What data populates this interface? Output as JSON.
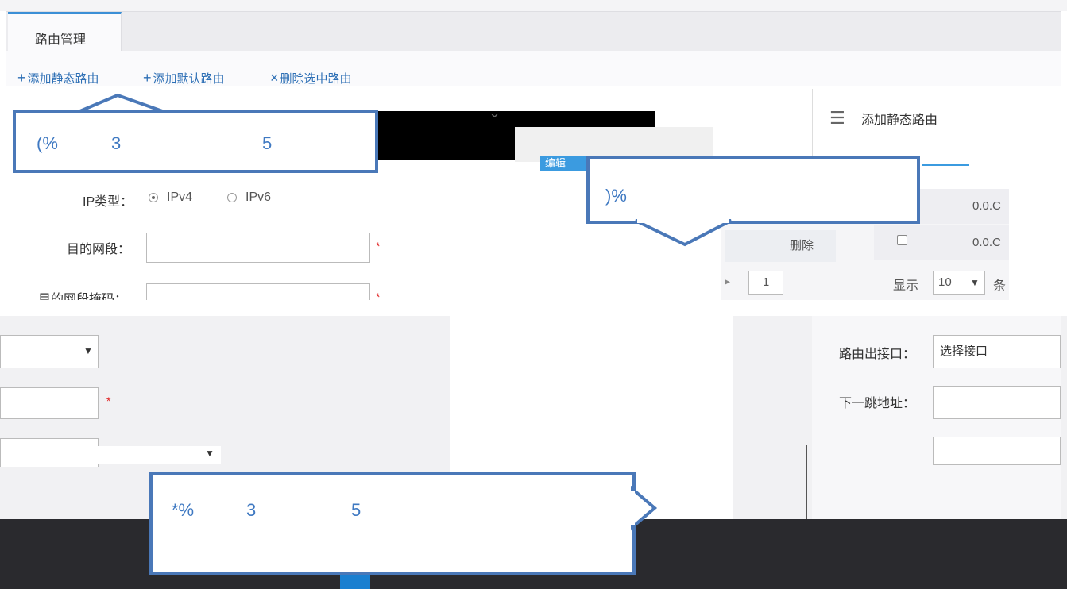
{
  "tab": {
    "label": "路由管理"
  },
  "toolbar": {
    "add_static": "添加静态路由",
    "add_default": "添加默认路由",
    "delete_selected": "删除选中路由"
  },
  "right_panel": {
    "title": "添加静态路由"
  },
  "form": {
    "ip_type_label": "IP类型：",
    "ipv4": "IPv4",
    "ipv6": "IPv6",
    "dest_segment_label": "目的网段：",
    "dest_mask_label": "目的网段掩码：",
    "required_mark": "*"
  },
  "table": {
    "rows": [
      {
        "ip": "0.0.C"
      },
      {
        "ip": "0.0.C"
      }
    ],
    "delete_btn": "删除",
    "page": "1",
    "show_label": "显示",
    "page_size": "10",
    "items_unit": "条"
  },
  "band_button": "编辑",
  "lower_form": {
    "out_interface_label": "路由出接口：",
    "out_interface_value": "选择接口",
    "next_hop_label": "下一跳地址：",
    "mark": "*"
  },
  "callouts": {
    "c1": [
      "(%",
      "3",
      "5"
    ],
    "c2": [
      ")%"
    ],
    "c3": [
      "*%",
      "3",
      "5"
    ]
  },
  "colors": {
    "accent": "#3b8fd6",
    "callout_border": "#4a78b8",
    "required": "#e02020"
  }
}
